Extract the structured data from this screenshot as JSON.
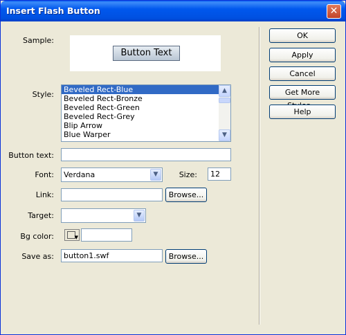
{
  "window": {
    "title": "Insert Flash Button"
  },
  "labels": {
    "sample": "Sample:",
    "style": "Style:",
    "button_text": "Button text:",
    "font": "Font:",
    "size": "Size:",
    "link": "Link:",
    "target": "Target:",
    "bg_color": "Bg color:",
    "save_as": "Save as:"
  },
  "sample": {
    "button_text": "Button Text"
  },
  "style_list": {
    "items": [
      "Beveled Rect-Blue",
      "Beveled Rect-Bronze",
      "Beveled Rect-Green",
      "Beveled Rect-Grey",
      "Blip Arrow",
      "Blue Warper"
    ],
    "selected": "Beveled Rect-Blue"
  },
  "fields": {
    "button_text": "",
    "font": "Verdana",
    "size": "12",
    "link": "",
    "target": "",
    "bg_color": "",
    "save_as": "button1.swf"
  },
  "buttons": {
    "ok": "OK",
    "apply": "Apply",
    "cancel": "Cancel",
    "get_more_styles": "Get More Styles...",
    "help": "Help",
    "browse_link": "Browse...",
    "browse_save": "Browse..."
  },
  "icons": {
    "close": "close-icon",
    "dropdown": "chevron-down-icon",
    "scroll_up": "scroll-up-icon",
    "scroll_down": "scroll-down-icon"
  },
  "colors": {
    "titlebar": "#0058ee",
    "selection": "#316ac5",
    "close_button": "#c1442a"
  }
}
